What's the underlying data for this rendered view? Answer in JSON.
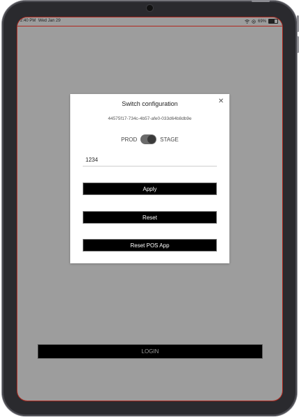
{
  "status_bar": {
    "time": "2:40 PM",
    "date": "Wed Jan 29",
    "battery": "69%",
    "battery_level": 0.69
  },
  "modal": {
    "title": "Switch configuration",
    "close_icon": "close-icon",
    "device_id": "44575f17-734c-4b57-afe0-033d64b8db9e",
    "env_left_label": "PROD",
    "env_right_label": "STAGE",
    "env_selected": "STAGE",
    "code_value": "1234",
    "apply_label": "Apply",
    "reset_label": "Reset",
    "reset_pos_label": "Reset POS App"
  },
  "login": {
    "label": "LOGIN"
  },
  "colors": {
    "screen_background": "#9d9d9d",
    "accent_red": "#b0281e",
    "button_background": "#000000"
  }
}
